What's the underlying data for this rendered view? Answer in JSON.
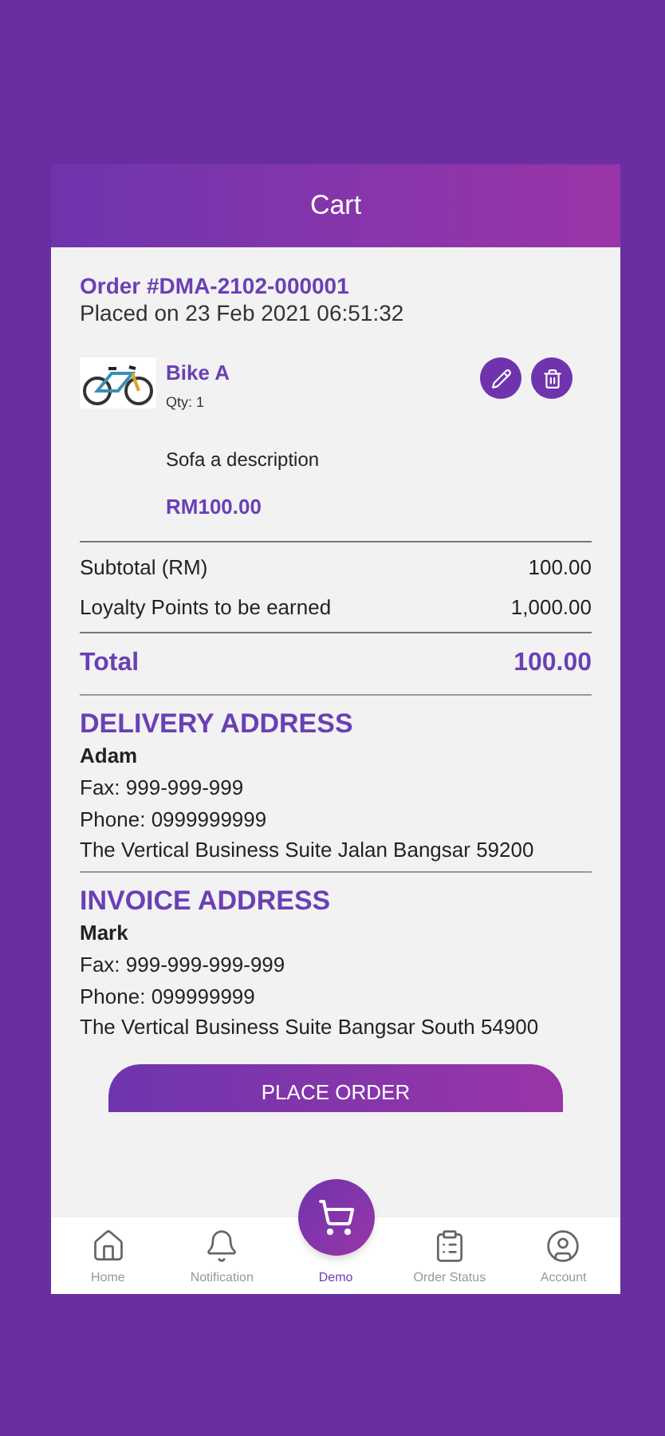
{
  "header": {
    "title": "Cart"
  },
  "order": {
    "number": "Order #DMA-2102-000001",
    "placed": "Placed on 23 Feb 2021 06:51:32"
  },
  "items": [
    {
      "kind": "picture",
      "name": "Bike A",
      "qty": "Qty: 1",
      "description": "Sofa a description",
      "price": "RM100.00"
    }
  ],
  "summary": [
    {
      "label": "Subtotal (RM)",
      "value": "100.00"
    },
    {
      "label": "Loyalty Points to be earned",
      "value": "1,000.00"
    }
  ],
  "total": {
    "label": "Total",
    "value": "100.00"
  },
  "addresses": [
    {
      "heading": "DELIVERY ADDRESS",
      "name": "Adam",
      "fax": "Fax: 999-999-999",
      "phone": "Phone: 0999999999",
      "address": "The Vertical Business Suite Jalan Bangsar 59200"
    },
    {
      "heading": "INVOICE ADDRESS",
      "name": "Mark",
      "fax": "Fax: 999-999-999-999",
      "phone": "Phone: 099999999",
      "address": "The Vertical Business Suite Bangsar South 54900"
    }
  ],
  "place_order": "PLACE ORDER",
  "nav": [
    {
      "kind": "home",
      "label": "Home",
      "selected": false
    },
    {
      "kind": "bell",
      "label": "Notification",
      "selected": false
    },
    {
      "kind": "cart",
      "label": "Demo",
      "selected": true
    },
    {
      "kind": "list",
      "label": "Order Status",
      "selected": false
    },
    {
      "kind": "account",
      "label": "Account",
      "selected": false
    }
  ]
}
